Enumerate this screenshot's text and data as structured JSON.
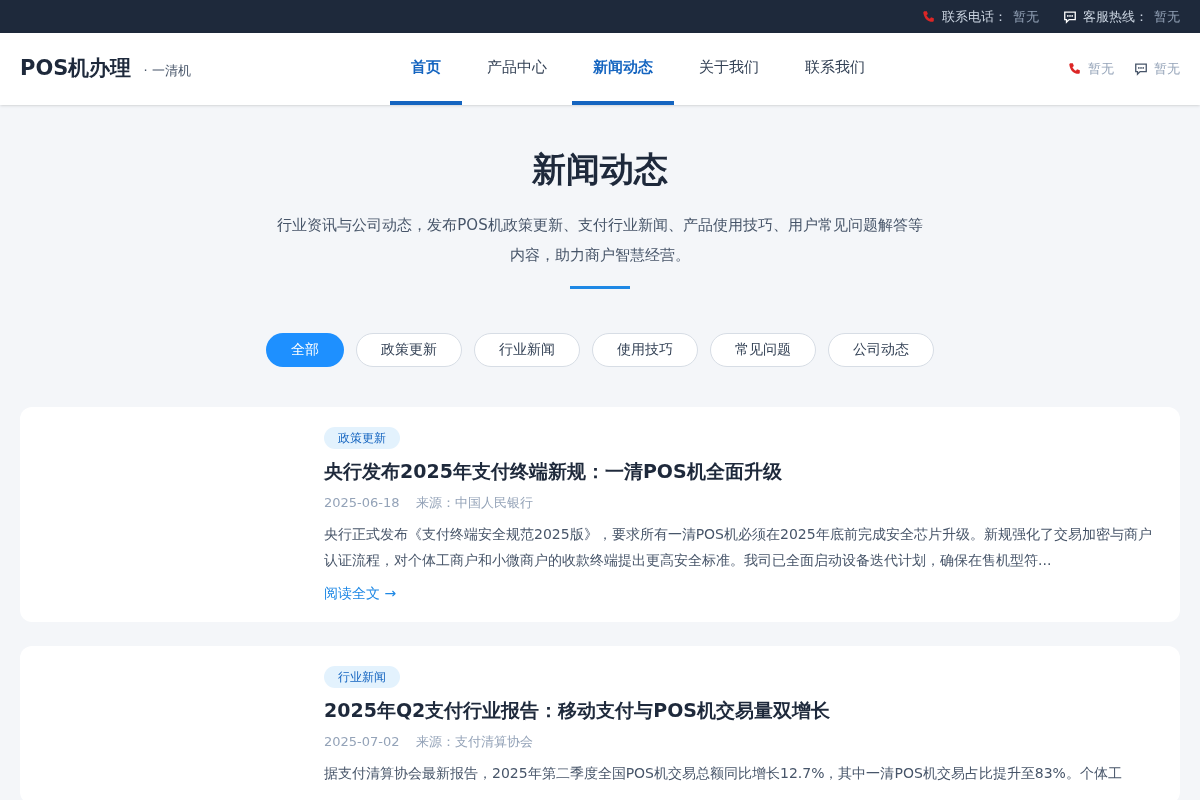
{
  "top_bar": {
    "items": [
      {
        "kind": "phone",
        "label": "联系电话：",
        "value": "暂无"
      },
      {
        "kind": "chat",
        "label": "客服热线：",
        "value": "暂无"
      }
    ]
  },
  "header": {
    "logo": "POS机办理",
    "tagline": "· 一清机",
    "nav": [
      {
        "label": "首页",
        "selected": true
      },
      {
        "label": "产品中心",
        "selected": false
      },
      {
        "label": "新闻动态",
        "selected": true
      },
      {
        "label": "关于我们",
        "selected": false
      },
      {
        "label": "联系我们",
        "selected": false
      }
    ],
    "contacts": [
      {
        "kind": "phone",
        "value": "暂无"
      },
      {
        "kind": "chat",
        "value": "暂无"
      }
    ]
  },
  "hero": {
    "title": "新闻动态",
    "description": "行业资讯与公司动态，发布POS机政策更新、支付行业新闻、产品使用技巧、用户常见问题解答等内容，助力商户智慧经营。"
  },
  "filters": [
    {
      "label": "全部",
      "selected": true
    },
    {
      "label": "政策更新",
      "selected": false
    },
    {
      "label": "行业新闻",
      "selected": false
    },
    {
      "label": "使用技巧",
      "selected": false
    },
    {
      "label": "常见问题",
      "selected": false
    },
    {
      "label": "公司动态",
      "selected": false
    }
  ],
  "articles": [
    {
      "tag": "政策更新",
      "title": "央行发布2025年支付终端新规：一清POS机全面升级",
      "date": "2025-06-18",
      "source": "来源：中国人民银行",
      "excerpt": "央行正式发布《支付终端安全规范2025版》，要求所有一清POS机必须在2025年底前完成安全芯片升级。新规强化了交易加密与商户认证流程，对个体工商户和小微商户的收款终端提出更高安全标准。我司已全面启动设备迭代计划，确保在售机型符...",
      "link": "阅读全文 →"
    },
    {
      "tag": "行业新闻",
      "title": "2025年Q2支付行业报告：移动支付与POS机交易量双增长",
      "date": "2025-07-02",
      "source": "来源：支付清算协会",
      "excerpt": "据支付清算协会最新报告，2025年第二季度全国POS机交易总额同比增长12.7%，其中一清POS机交易占比提升至83%。个体工"
    }
  ]
}
